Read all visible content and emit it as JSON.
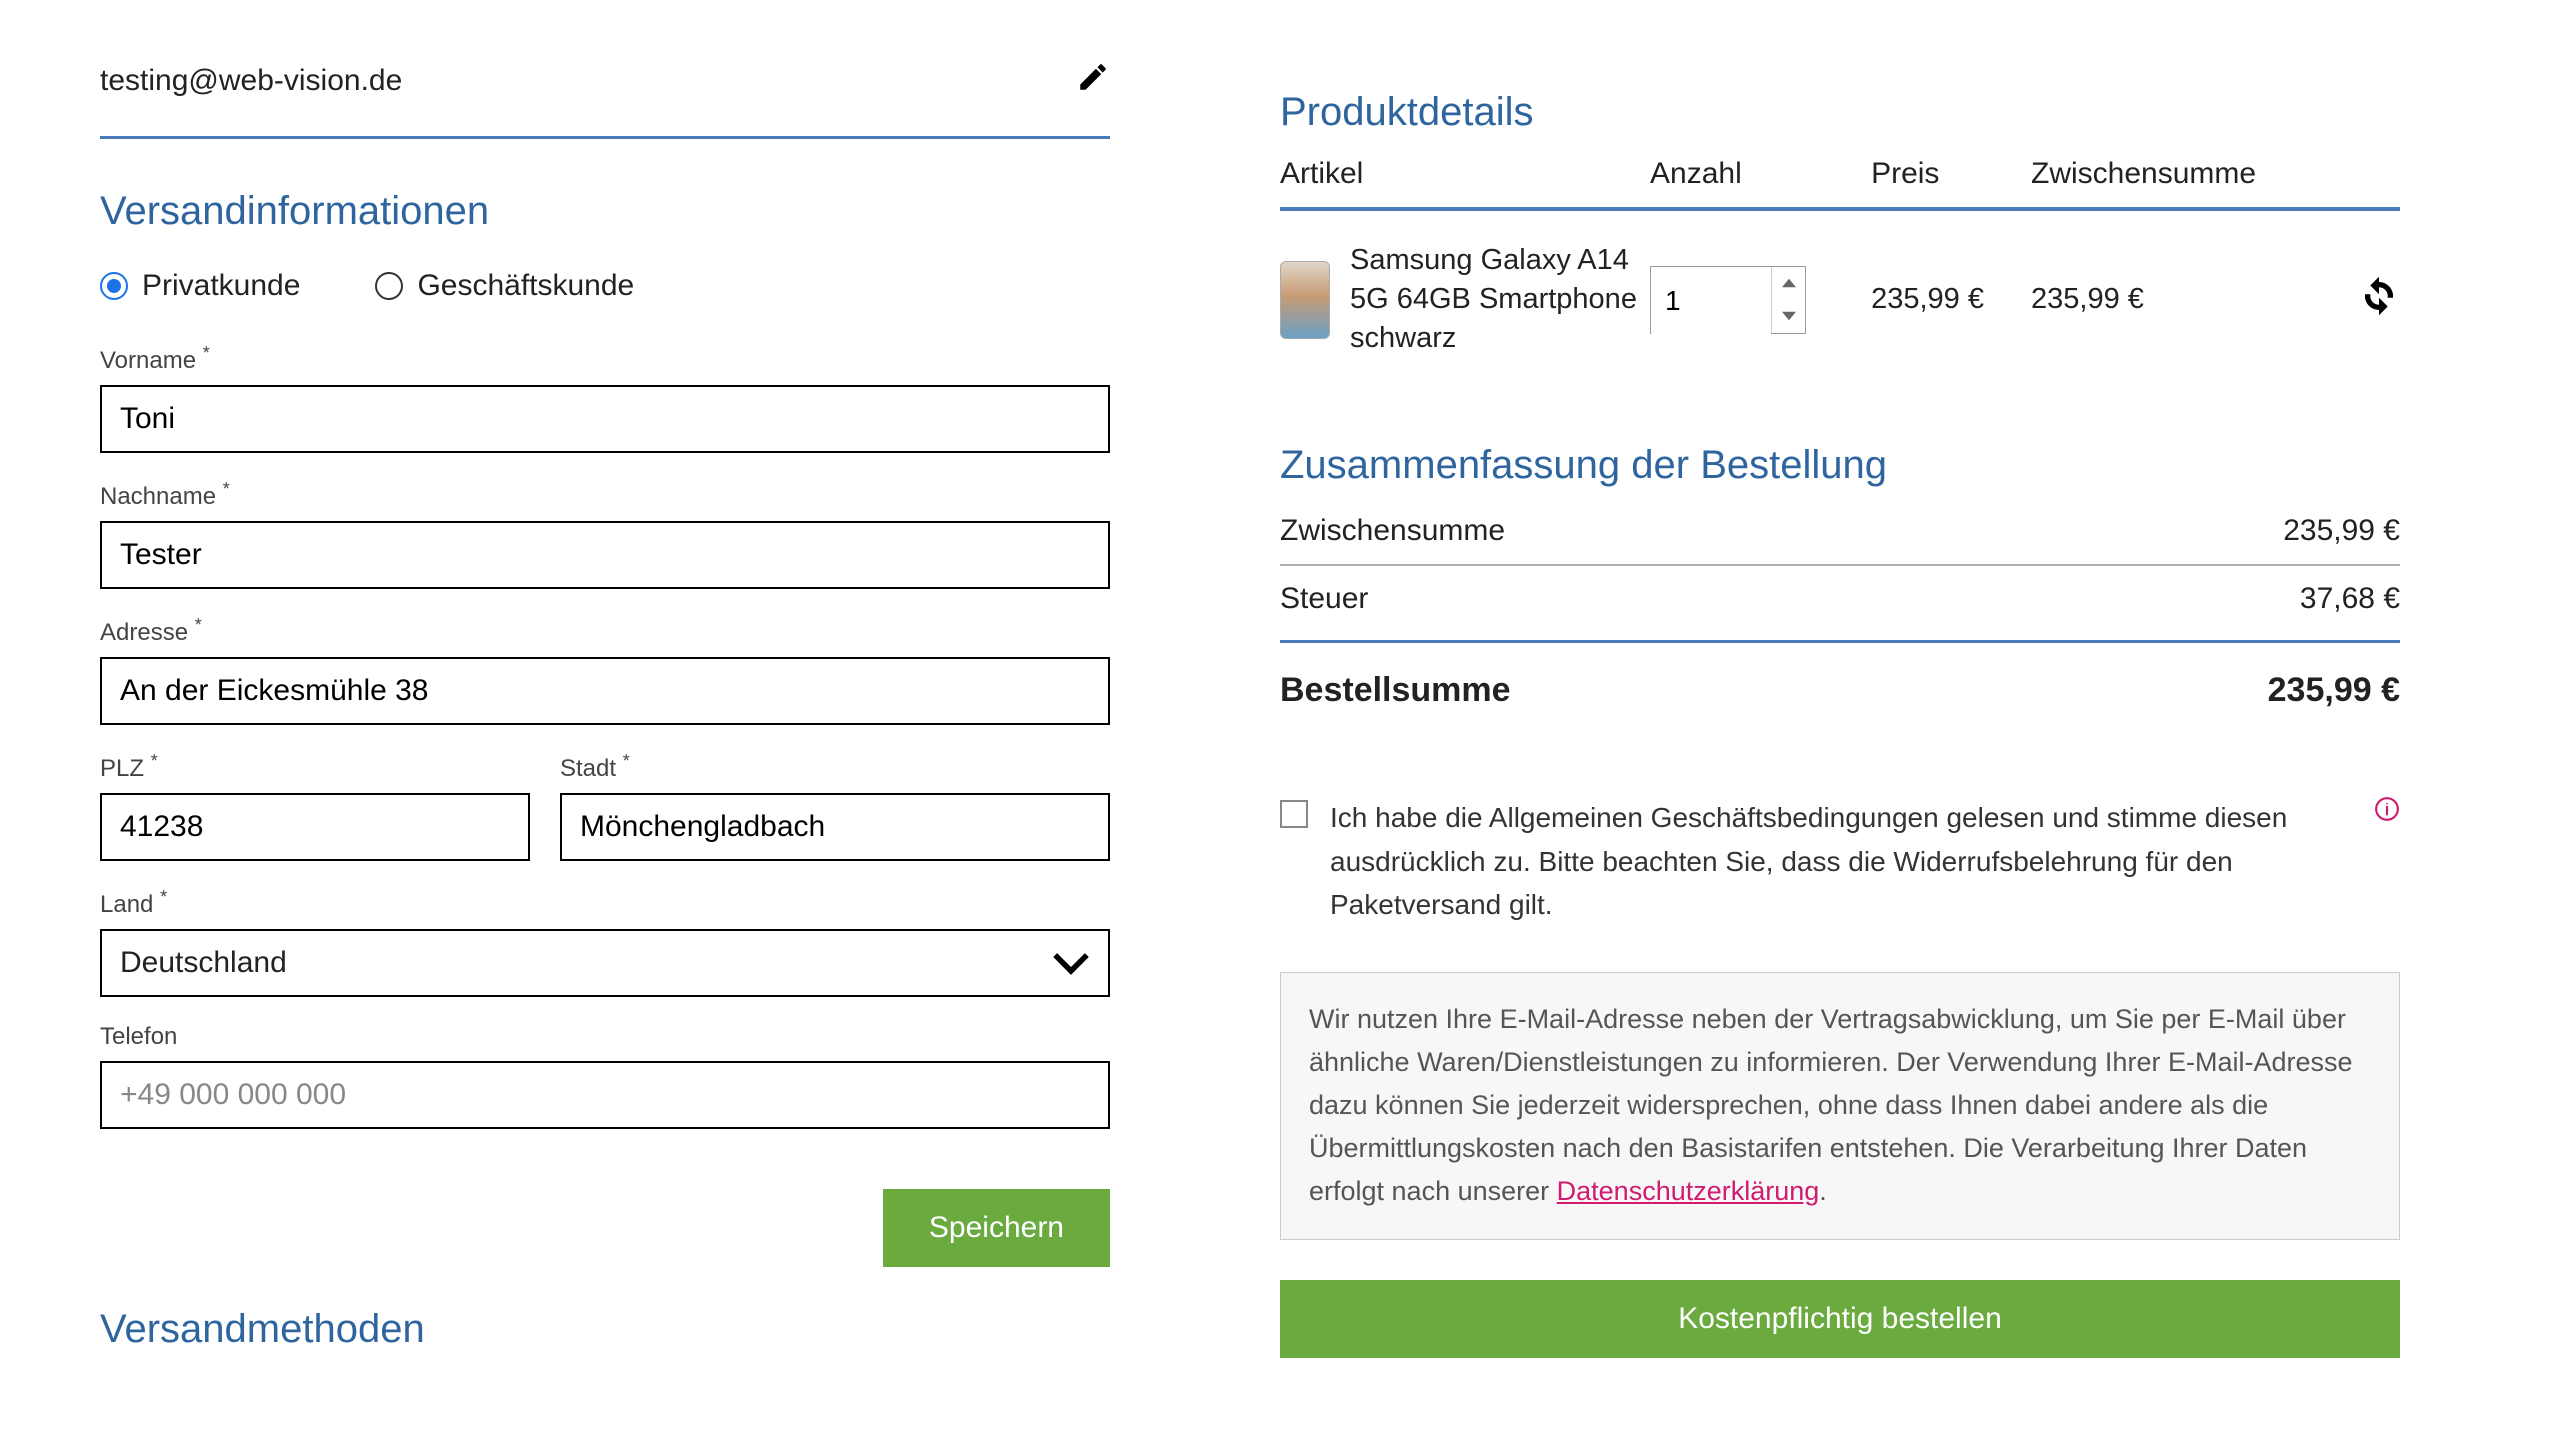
{
  "email": "testing@web-vision.de",
  "shipping": {
    "heading": "Versandinformationen",
    "private_label": "Privatkunde",
    "business_label": "Geschäftskunde",
    "firstname_label": "Vorname",
    "firstname_value": "Toni",
    "lastname_label": "Nachname",
    "lastname_value": "Tester",
    "address_label": "Adresse",
    "address_value": "An der Eickesmühle 38",
    "zip_label": "PLZ",
    "zip_value": "41238",
    "city_label": "Stadt",
    "city_value": "Mönchengladbach",
    "country_label": "Land",
    "country_value": "Deutschland",
    "phone_label": "Telefon",
    "phone_placeholder": "+49 000 000 000",
    "phone_value": "",
    "save_label": "Speichern"
  },
  "shipping_methods_heading": "Versandmethoden",
  "product_details": {
    "heading": "Produktdetails",
    "col_article": "Artikel",
    "col_qty": "Anzahl",
    "col_price": "Preis",
    "col_subtotal": "Zwischensumme",
    "item": {
      "name": "Samsung Galaxy A14 5G 64GB Smartphone schwarz",
      "qty": "1",
      "price": "235,99 €",
      "subtotal": "235,99 €"
    }
  },
  "summary": {
    "heading": "Zusammenfassung der Bestellung",
    "subtotal_label": "Zwischensumme",
    "subtotal_value": "235,99 €",
    "tax_label": "Steuer",
    "tax_value": "37,68 €",
    "total_label": "Bestellsumme",
    "total_value": "235,99 €"
  },
  "terms_text": "Ich habe die Allgemeinen Geschäftsbedingungen gelesen und stimme diesen ausdrücklich zu. Bitte beachten Sie, dass die Widerrufsbelehrung für den Paketversand gilt.",
  "notice_text": "Wir nutzen Ihre E-Mail-Adresse neben der Vertragsabwicklung, um Sie per E-Mail über ähnliche Waren/Dienstleistungen zu informieren. Der Verwendung Ihrer E-Mail-Adresse dazu können Sie jederzeit widersprechen, ohne dass Ihnen dabei andere als die Übermittlungskosten nach den Basistarifen entstehen. Die Verarbeitung Ihrer Daten erfolgt nach unserer ",
  "notice_link": "Datenschutzerklärung",
  "notice_after": ".",
  "order_button": "Kostenpflichtig bestellen"
}
